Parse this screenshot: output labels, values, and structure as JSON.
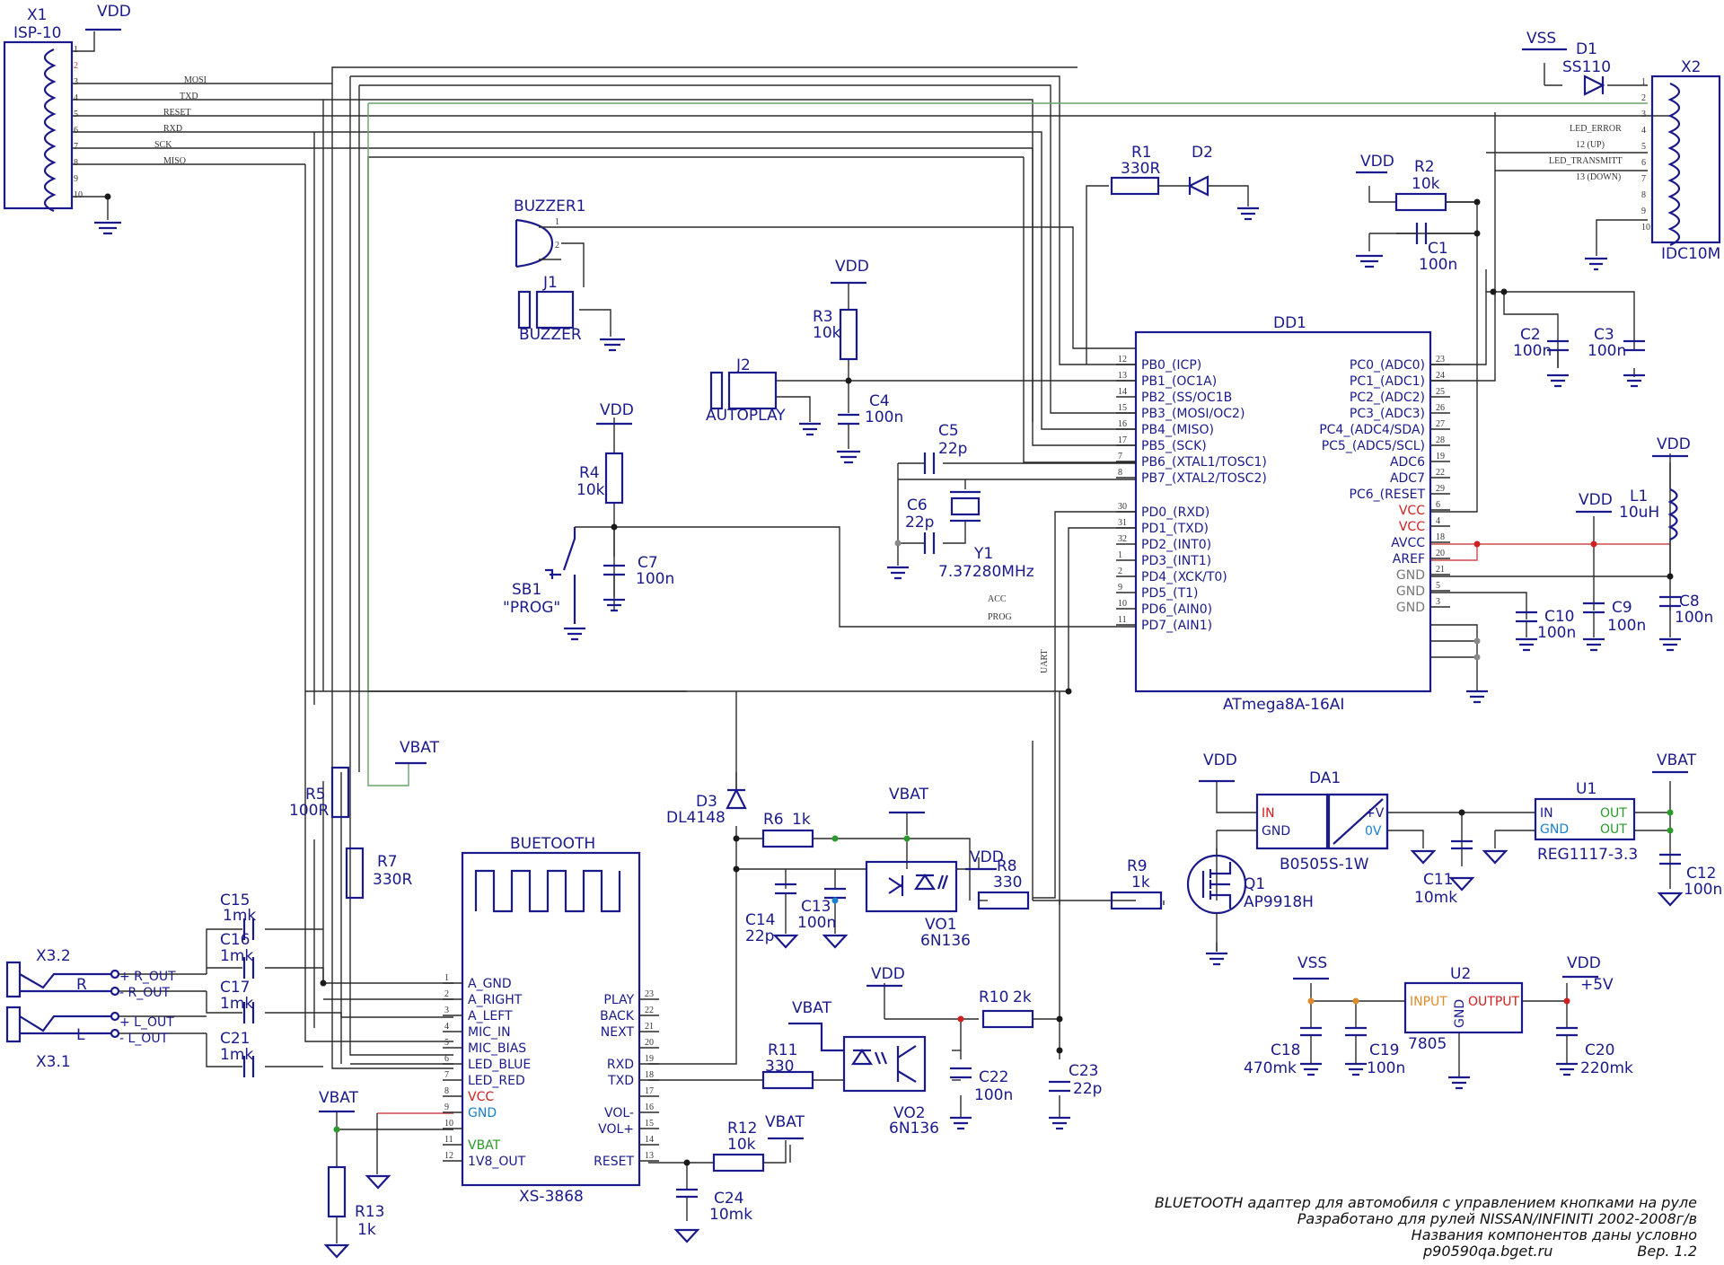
{
  "supply": {
    "vdd": "VDD",
    "vss": "VSS",
    "vbat": "VBAT",
    "plus5": "+5V"
  },
  "x1": {
    "ref": "X1",
    "type": "ISP-10",
    "pins": [
      "1",
      "2",
      "3",
      "4",
      "5",
      "6",
      "7",
      "8",
      "9",
      "10"
    ],
    "signals": [
      "MOSI",
      "TXD",
      "RESET",
      "RXD",
      "SCK",
      "MISO"
    ]
  },
  "x2": {
    "ref": "X2",
    "type": "IDC10M",
    "pins": [
      "1",
      "2",
      "3",
      "4",
      "5",
      "6",
      "7",
      "8",
      "9",
      "10"
    ],
    "signals": [
      "LED_ERROR",
      "12 (UP)",
      "LED_TRANSMITT",
      "13 (DOWN)"
    ]
  },
  "d1": {
    "ref": "D1",
    "value": "SS110"
  },
  "buzzer": {
    "ref": "BUZZER1",
    "j1": "J1",
    "j1_label": "BUZZER",
    "pin1": "1",
    "pin2": "2"
  },
  "r1": {
    "ref": "R1",
    "value": "330R"
  },
  "d2": {
    "ref": "D2"
  },
  "r2": {
    "ref": "R2",
    "value": "10k"
  },
  "c1": {
    "ref": "C1",
    "value": "100n"
  },
  "r3": {
    "ref": "R3",
    "value": "10k"
  },
  "c4": {
    "ref": "C4",
    "value": "100n"
  },
  "j2": {
    "ref": "J2",
    "label": "AUTOPLAY"
  },
  "r4": {
    "ref": "R4",
    "value": "10k"
  },
  "c7": {
    "ref": "C7",
    "value": "100n"
  },
  "sb1": {
    "ref": "SB1",
    "label": "\"PROG\""
  },
  "c5": {
    "ref": "C5",
    "value": "22p"
  },
  "c6": {
    "ref": "C6",
    "value": "22p"
  },
  "y1": {
    "ref": "Y1",
    "value": "7.37280MHz"
  },
  "dd1": {
    "ref": "DD1",
    "part": "ATmega8A-16AI",
    "left": [
      {
        "n": "12",
        "t": "PB0_(ICP)"
      },
      {
        "n": "13",
        "t": "PB1_(OC1A)"
      },
      {
        "n": "14",
        "t": "PB2_(SS/OC1B"
      },
      {
        "n": "15",
        "t": "PB3_(MOSI/OC2)"
      },
      {
        "n": "16",
        "t": "PB4_(MISO)"
      },
      {
        "n": "17",
        "t": "PB5_(SCK)"
      },
      {
        "n": "7",
        "t": "PB6_(XTAL1/TOSC1)"
      },
      {
        "n": "8",
        "t": "PB7_(XTAL2/TOSC2)"
      },
      {
        "n": "30",
        "t": "PD0_(RXD)"
      },
      {
        "n": "31",
        "t": "PD1_(TXD)"
      },
      {
        "n": "32",
        "t": "PD2_(INT0)"
      },
      {
        "n": "1",
        "t": "PD3_(INT1)"
      },
      {
        "n": "2",
        "t": "PD4_(XCK/T0)"
      },
      {
        "n": "9",
        "t": "PD5_(T1)"
      },
      {
        "n": "10",
        "t": "PD6_(AIN0)"
      },
      {
        "n": "11",
        "t": "PD7_(AIN1)"
      }
    ],
    "right": [
      {
        "n": "23",
        "t": "PC0_(ADC0)"
      },
      {
        "n": "24",
        "t": "PC1_(ADC1)"
      },
      {
        "n": "25",
        "t": "PC2_(ADC2)"
      },
      {
        "n": "26",
        "t": "PC3_(ADC3)"
      },
      {
        "n": "27",
        "t": "PC4_(ADC4/SDA)"
      },
      {
        "n": "28",
        "t": "PC5_(ADC5/SCL)"
      },
      {
        "n": "19",
        "t": "ADC6"
      },
      {
        "n": "22",
        "t": "ADC7"
      },
      {
        "n": "29",
        "t": "PC6_(RESET"
      },
      {
        "n": "6",
        "t": "VCC"
      },
      {
        "n": "4",
        "t": "VCC"
      },
      {
        "n": "18",
        "t": "AVCC"
      },
      {
        "n": "20",
        "t": "AREF"
      },
      {
        "n": "21",
        "t": "GND"
      },
      {
        "n": "5",
        "t": "GND"
      },
      {
        "n": "3",
        "t": "GND"
      }
    ],
    "acc": "ACC",
    "prog": "PROG",
    "uart": "UART"
  },
  "c2": {
    "ref": "C2",
    "value": "100n"
  },
  "c3": {
    "ref": "C3",
    "value": "100n"
  },
  "l1": {
    "ref": "L1",
    "value": "10uH"
  },
  "c10": {
    "ref": "C10",
    "value": "100n"
  },
  "c9": {
    "ref": "C9",
    "value": "100n"
  },
  "c8": {
    "ref": "C8",
    "value": "100n"
  },
  "bt": {
    "ref": "BUETOOTH",
    "part": "XS-3868",
    "left": [
      {
        "n": "1",
        "t": "A_GND"
      },
      {
        "n": "2",
        "t": "A_RIGHT"
      },
      {
        "n": "3",
        "t": "A_LEFT"
      },
      {
        "n": "4",
        "t": "MIC_IN"
      },
      {
        "n": "5",
        "t": "MIC_BIAS"
      },
      {
        "n": "6",
        "t": "LED_BLUE"
      },
      {
        "n": "7",
        "t": "LED_RED"
      },
      {
        "n": "8",
        "t": "VCC"
      },
      {
        "n": "9",
        "t": "GND"
      },
      {
        "n": "10",
        "t": ""
      },
      {
        "n": "11",
        "t": "VBAT"
      },
      {
        "n": "12",
        "t": "1V8_OUT"
      }
    ],
    "right": [
      {
        "n": "23",
        "t": "PLAY"
      },
      {
        "n": "22",
        "t": "BACK"
      },
      {
        "n": "21",
        "t": "NEXT"
      },
      {
        "n": "20",
        "t": ""
      },
      {
        "n": "19",
        "t": "RXD"
      },
      {
        "n": "18",
        "t": "TXD"
      },
      {
        "n": "17",
        "t": ""
      },
      {
        "n": "16",
        "t": "VOL-"
      },
      {
        "n": "15",
        "t": "VOL+"
      },
      {
        "n": "14",
        "t": ""
      },
      {
        "n": "13",
        "t": "RESET"
      }
    ]
  },
  "r5": {
    "ref": "R5",
    "value": "100R"
  },
  "r7": {
    "ref": "R7",
    "value": "330R"
  },
  "c15": {
    "ref": "C15",
    "value": "1mk"
  },
  "c16": {
    "ref": "C16",
    "value": "1mk"
  },
  "c17": {
    "ref": "C17",
    "value": "1mk"
  },
  "c21": {
    "ref": "C21",
    "value": "1mk"
  },
  "x3": {
    "ref2": "X3.2",
    "ref1": "X3.1",
    "r": "R",
    "l": "L",
    "r_out_p": "+ R_OUT",
    "r_out_m": "- R_OUT",
    "l_out_p": "+ L_OUT",
    "l_out_m": "- L_OUT"
  },
  "r13": {
    "ref": "R13",
    "value": "1k"
  },
  "d3": {
    "ref": "D3",
    "value": "DL4148"
  },
  "r6": {
    "ref": "R6",
    "value": "1k"
  },
  "c14": {
    "ref": "C14",
    "value": "22p"
  },
  "c13": {
    "ref": "C13",
    "value": "100n"
  },
  "vo1": {
    "ref": "VO1",
    "value": "6N136"
  },
  "r8": {
    "ref": "R8",
    "value": "330"
  },
  "r9": {
    "ref": "R9",
    "value": "1k"
  },
  "q1": {
    "ref": "Q1",
    "value": "AP9918H"
  },
  "da1": {
    "ref": "DA1",
    "part": "B0505S-1W",
    "in": "IN",
    "gnd": "GND",
    "pv": "+V",
    "ov": "0V"
  },
  "u1": {
    "ref": "U1",
    "part": "REG1117-3.3",
    "in": "IN",
    "gnd": "GND",
    "out": "OUT"
  },
  "c11": {
    "ref": "C11",
    "value": "10mk"
  },
  "c12": {
    "ref": "C12",
    "value": "100n"
  },
  "r10": {
    "ref": "R10",
    "value": "2k"
  },
  "r11": {
    "ref": "R11",
    "value": "330"
  },
  "vo2": {
    "ref": "VO2",
    "value": "6N136"
  },
  "c22": {
    "ref": "C22",
    "value": "100n"
  },
  "c23": {
    "ref": "C23",
    "value": "22p"
  },
  "r12": {
    "ref": "R12",
    "value": "10k"
  },
  "c24": {
    "ref": "C24",
    "value": "10mk"
  },
  "u2": {
    "ref": "U2",
    "part": "7805",
    "input": "INPUT",
    "output": "OUTPUT",
    "gnd": "GND"
  },
  "c18": {
    "ref": "C18",
    "value": "470mk"
  },
  "c19": {
    "ref": "C19",
    "value": "100n"
  },
  "c20": {
    "ref": "C20",
    "value": "220mk"
  },
  "footer": {
    "line1": "BLUETOOTH адаптер для автомобиля с управлением кнопками на руле",
    "line2": "Разработано для рулей NISSAN/INFINITI 2002-2008г/в",
    "line3": "Названия компонентов даны условно",
    "site": "p90590qa.bget.ru",
    "ver": "Вер. 1.2"
  }
}
